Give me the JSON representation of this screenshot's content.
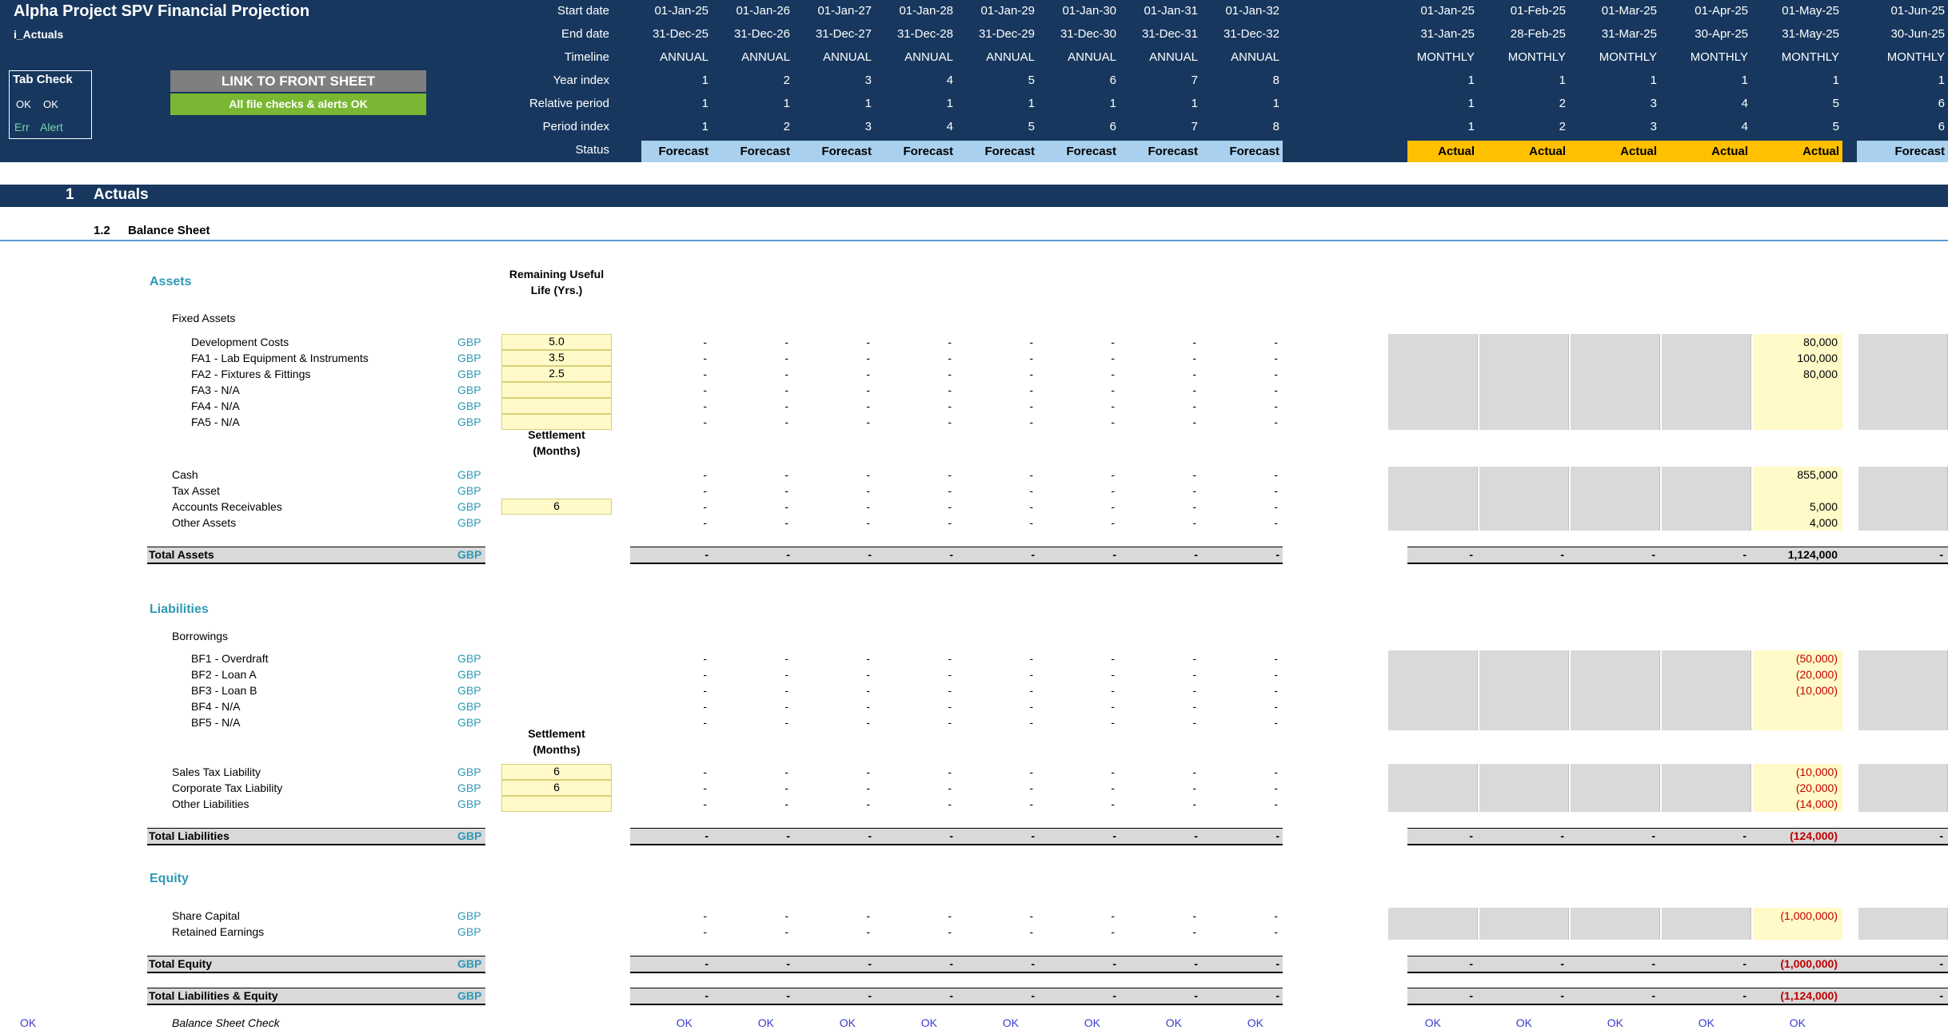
{
  "title": "Alpha Project SPV Financial Projection",
  "sheet_name": "i_Actuals",
  "tab_check": {
    "title": "Tab Check",
    "ok1": "OK",
    "ok2": "OK",
    "err": "Err",
    "alert": "Alert"
  },
  "buttons": {
    "link_front": "LINK TO FRONT SHEET",
    "checks_ok": "All file checks & alerts OK"
  },
  "timeline_labels": [
    "Start date",
    "End date",
    "Timeline",
    "Year index",
    "Relative period",
    "Period index",
    "Status"
  ],
  "annual_cols": [
    {
      "start": "01-Jan-25",
      "end": "31-Dec-25",
      "timeline": "ANNUAL",
      "year": "1",
      "rel": "1",
      "idx": "1",
      "status": "Forecast"
    },
    {
      "start": "01-Jan-26",
      "end": "31-Dec-26",
      "timeline": "ANNUAL",
      "year": "2",
      "rel": "1",
      "idx": "2",
      "status": "Forecast"
    },
    {
      "start": "01-Jan-27",
      "end": "31-Dec-27",
      "timeline": "ANNUAL",
      "year": "3",
      "rel": "1",
      "idx": "3",
      "status": "Forecast"
    },
    {
      "start": "01-Jan-28",
      "end": "31-Dec-28",
      "timeline": "ANNUAL",
      "year": "4",
      "rel": "1",
      "idx": "4",
      "status": "Forecast"
    },
    {
      "start": "01-Jan-29",
      "end": "31-Dec-29",
      "timeline": "ANNUAL",
      "year": "5",
      "rel": "1",
      "idx": "5",
      "status": "Forecast"
    },
    {
      "start": "01-Jan-30",
      "end": "31-Dec-30",
      "timeline": "ANNUAL",
      "year": "6",
      "rel": "1",
      "idx": "6",
      "status": "Forecast"
    },
    {
      "start": "01-Jan-31",
      "end": "31-Dec-31",
      "timeline": "ANNUAL",
      "year": "7",
      "rel": "1",
      "idx": "7",
      "status": "Forecast"
    },
    {
      "start": "01-Jan-32",
      "end": "31-Dec-32",
      "timeline": "ANNUAL",
      "year": "8",
      "rel": "1",
      "idx": "8",
      "status": "Forecast"
    }
  ],
  "monthly_cols": [
    {
      "start": "01-Jan-25",
      "end": "31-Jan-25",
      "timeline": "MONTHLY",
      "year": "1",
      "rel": "1",
      "idx": "1",
      "status": "Actual"
    },
    {
      "start": "01-Feb-25",
      "end": "28-Feb-25",
      "timeline": "MONTHLY",
      "year": "1",
      "rel": "2",
      "idx": "2",
      "status": "Actual"
    },
    {
      "start": "01-Mar-25",
      "end": "31-Mar-25",
      "timeline": "MONTHLY",
      "year": "1",
      "rel": "3",
      "idx": "3",
      "status": "Actual"
    },
    {
      "start": "01-Apr-25",
      "end": "30-Apr-25",
      "timeline": "MONTHLY",
      "year": "1",
      "rel": "4",
      "idx": "4",
      "status": "Actual"
    },
    {
      "start": "01-May-25",
      "end": "31-May-25",
      "timeline": "MONTHLY",
      "year": "1",
      "rel": "5",
      "idx": "5",
      "status": "Actual"
    },
    {
      "start": "01-Jun-25",
      "end": "30-Jun-25",
      "timeline": "MONTHLY",
      "year": "1",
      "rel": "6",
      "idx": "6",
      "status": "Forecast"
    }
  ],
  "section": {
    "number": "1",
    "title": "Actuals"
  },
  "subsection": {
    "number": "1.2",
    "title": "Balance Sheet"
  },
  "col_headers": {
    "useful_life": [
      "Remaining Useful",
      "Life (Yrs.)"
    ],
    "settlement": [
      "Settlement",
      "(Months)"
    ]
  },
  "currency": "GBP",
  "dash": "-",
  "groups": {
    "assets": "Assets",
    "liabilities": "Liabilities",
    "equity": "Equity"
  },
  "subgroups": {
    "fixed_assets": "Fixed Assets",
    "borrowings": "Borrowings"
  },
  "rows": {
    "dev_costs": {
      "label": "Development Costs",
      "input": "5.0",
      "may": "80,000"
    },
    "fa1": {
      "label": "FA1 - Lab Equipment & Instruments",
      "input": "3.5",
      "may": "100,000"
    },
    "fa2": {
      "label": "FA2 - Fixtures & Fittings",
      "input": "2.5",
      "may": "80,000"
    },
    "fa3": {
      "label": "FA3 - N/A",
      "input": "",
      "may": ""
    },
    "fa4": {
      "label": "FA4 - N/A",
      "input": "",
      "may": ""
    },
    "fa5": {
      "label": "FA5 - N/A",
      "input": "",
      "may": ""
    },
    "cash": {
      "label": "Cash",
      "input": "",
      "may": "855,000"
    },
    "tax_asset": {
      "label": "Tax Asset",
      "input": "",
      "may": ""
    },
    "receivables": {
      "label": "Accounts Receivables",
      "input": "6",
      "may": "5,000"
    },
    "other_assets": {
      "label": "Other Assets",
      "input": "",
      "may": "4,000"
    },
    "total_assets": {
      "label": "Total Assets",
      "may": "1,124,000"
    },
    "bf1": {
      "label": "BF1 - Overdraft",
      "may": "(50,000)"
    },
    "bf2": {
      "label": "BF2 - Loan A",
      "may": "(20,000)"
    },
    "bf3": {
      "label": "BF3 - Loan B",
      "may": "(10,000)"
    },
    "bf4": {
      "label": "BF4 - N/A",
      "may": ""
    },
    "bf5": {
      "label": "BF5 - N/A",
      "may": ""
    },
    "sales_tax": {
      "label": "Sales Tax Liability",
      "input": "6",
      "may": "(10,000)"
    },
    "corp_tax": {
      "label": "Corporate Tax Liability",
      "input": "6",
      "may": "(20,000)"
    },
    "other_liab": {
      "label": "Other Liabilities",
      "input": "",
      "may": "(14,000)"
    },
    "total_liab": {
      "label": "Total Liabilities",
      "may": "(124,000)"
    },
    "share_capital": {
      "label": "Share Capital",
      "may": "(1,000,000)"
    },
    "retained": {
      "label": "Retained Earnings",
      "may": ""
    },
    "total_equity": {
      "label": "Total Equity",
      "may": "(1,000,000)"
    },
    "total_le": {
      "label": "Total Liabilities & Equity",
      "may": "(1,124,000)"
    }
  },
  "check": {
    "label": "Balance Sheet Check",
    "left_ok": "OK",
    "ok": "OK"
  },
  "colors": {
    "header_bg": "#17375e",
    "forecast": "#a9d0ee",
    "actual": "#ffc000",
    "group_text": "#2e9ab5",
    "input_fill": "#fffac8",
    "negative": "#c00000",
    "ok_text": "#3b3bcc",
    "link_button": "#7f7f7f",
    "alerts_ok": "#7ab833"
  }
}
